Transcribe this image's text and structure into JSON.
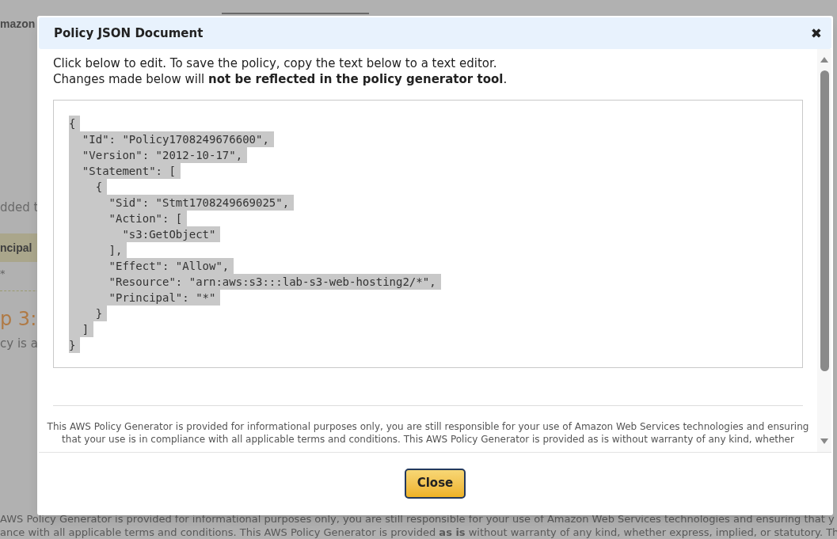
{
  "background_page": {
    "logo_fragment": "mazon",
    "text_fragment": "dded t",
    "column_header_fragment": "ncipal",
    "cell_fragment": "*",
    "step_heading_fragment": "p 3:",
    "paragraph_fragment": "cy is a",
    "footer_lines": [
      "AWS Policy Generator is provided for informational purposes only, you are still responsible for your use of Amazon Web Services technologies and ensuring that y",
      "ance with all applicable terms and conditions. This AWS Policy Generator is provided **as is** without warranty of any kind, whether express, implied, or statutory. Th"
    ]
  },
  "dialog": {
    "title": "Policy JSON Document",
    "close_icon": "✖",
    "instructions": [
      "Click below to edit. To save the policy, copy the text below to a text editor.",
      "Changes made below will **not be reflected in the policy generator tool**."
    ],
    "policy_editor": {
      "selected": true,
      "lines": [
        "{",
        "  \"Id\": \"Policy1708249676600\",",
        "  \"Version\": \"2012-10-17\",",
        "  \"Statement\": [",
        "    {",
        "      \"Sid\": \"Stmt1708249669025\",",
        "      \"Action\": [",
        "        \"s3:GetObject\"",
        "      ],",
        "      \"Effect\": \"Allow\",",
        "      \"Resource\": \"arn:aws:s3:::lab-s3-web-hosting2/*\",",
        "      \"Principal\": \"*\"",
        "    }",
        "  ]",
        "}"
      ]
    },
    "disclaimer": [
      "This AWS Policy Generator is provided for informational purposes only, you are still responsible for your use of Amazon Web Services technologies and ensuring",
      "that your use is in compliance with all applicable terms and conditions. This AWS Policy Generator is provided as is without warranty of any kind, whether"
    ],
    "close_button": "Close"
  }
}
